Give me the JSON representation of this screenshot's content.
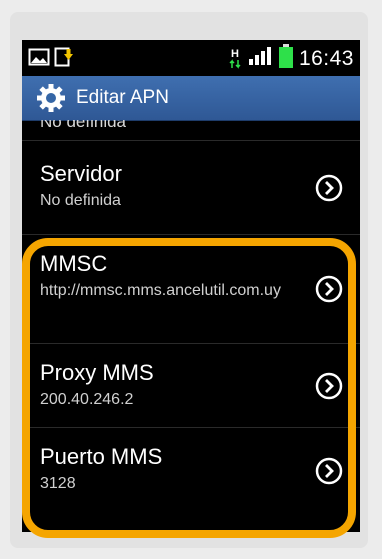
{
  "status_bar": {
    "time": "16:43",
    "network_type": "H",
    "icons": [
      "gallery-icon",
      "download-icon",
      "hspa-icon",
      "signal-icon",
      "battery-icon"
    ]
  },
  "header": {
    "icon": "gear-icon",
    "title": "Editar APN"
  },
  "list": {
    "partial_value": "No definida",
    "items": [
      {
        "name": "Servidor",
        "value": "No definida"
      },
      {
        "name": "MMSC",
        "value": "http://mmsc.mms.ancelutil.com.uy"
      },
      {
        "name": "Proxy MMS",
        "value": "200.40.246.2"
      },
      {
        "name": "Puerto MMS",
        "value": "3128"
      }
    ]
  },
  "colors": {
    "title_bar": "#3566a6",
    "highlight": "#f5a500",
    "battery": "#2ee04a"
  }
}
